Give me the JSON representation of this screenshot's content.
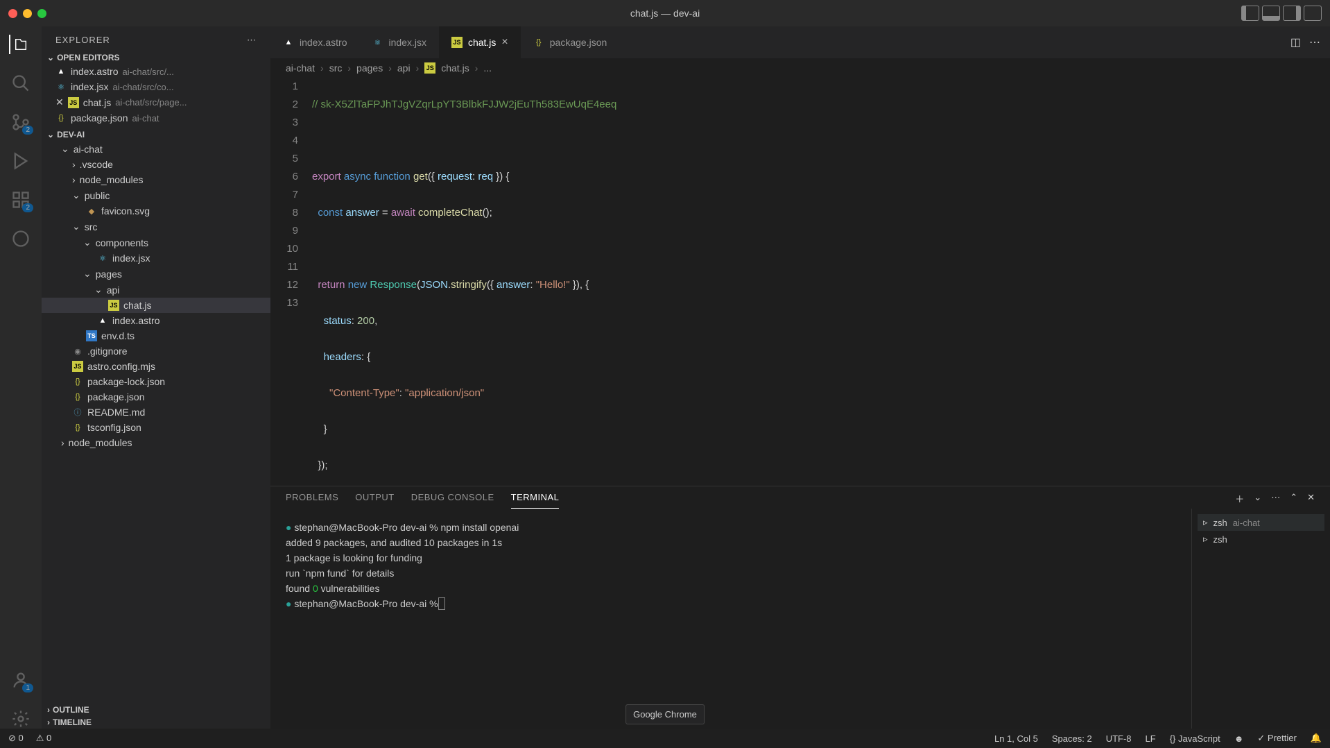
{
  "window": {
    "title": "chat.js — dev-ai"
  },
  "sidebar": {
    "title": "EXPLORER",
    "openEditors": "OPEN EDITORS",
    "project": "DEV-AI",
    "outline": "OUTLINE",
    "timeline": "TIMELINE",
    "editors": [
      {
        "name": "index.astro",
        "path": "ai-chat/src/..."
      },
      {
        "name": "index.jsx",
        "path": "ai-chat/src/co..."
      },
      {
        "name": "chat.js",
        "path": "ai-chat/src/page..."
      },
      {
        "name": "package.json",
        "path": "ai-chat"
      }
    ],
    "tree": {
      "aiChat": "ai-chat",
      "vscode": ".vscode",
      "nodeModules": "node_modules",
      "public": "public",
      "favicon": "favicon.svg",
      "src": "src",
      "components": "components",
      "indexJsx": "index.jsx",
      "pages": "pages",
      "api": "api",
      "chatJs": "chat.js",
      "indexAstro": "index.astro",
      "envdts": "env.d.ts",
      "gitignore": ".gitignore",
      "astroConfig": "astro.config.mjs",
      "pkgLock": "package-lock.json",
      "pkg": "package.json",
      "readme": "README.md",
      "tsconfig": "tsconfig.json",
      "nodeModules2": "node_modules"
    }
  },
  "tabs": [
    {
      "name": "index.astro"
    },
    {
      "name": "index.jsx"
    },
    {
      "name": "chat.js"
    },
    {
      "name": "package.json"
    }
  ],
  "breadcrumb": [
    "ai-chat",
    "src",
    "pages",
    "api",
    "chat.js",
    "..."
  ],
  "code": {
    "lineNumbers": [
      "1",
      "2",
      "3",
      "4",
      "5",
      "6",
      "7",
      "8",
      "9",
      "10",
      "11",
      "12",
      "13"
    ],
    "l1_comment": "// 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",
    "l3_export": "export",
    "l3_async": "async",
    "l3_function": "function",
    "l3_get": "get",
    "l3_request": "request",
    "l3_req": "req",
    "l4_const": "const",
    "l4_answer": "answer",
    "l4_await": "await",
    "l4_complete": "completeChat",
    "l6_return": "return",
    "l6_new": "new",
    "l6_Response": "Response",
    "l6_JSON": "JSON",
    "l6_stringify": "stringify",
    "l6_answer": "answer",
    "l6_hello": "\"Hello!\"",
    "l7_status": "status",
    "l7_200": "200",
    "l8_headers": "headers",
    "l9_ct": "\"Content-Type\"",
    "l9_val": "\"application/json\""
  },
  "panel": {
    "tabs": [
      "PROBLEMS",
      "OUTPUT",
      "DEBUG CONSOLE",
      "TERMINAL"
    ],
    "terminal": {
      "line1_prompt": "stephan@MacBook-Pro dev-ai % ",
      "line1_cmd": "npm install openai",
      "line2": "added 9 packages, and audited 10 packages in 1s",
      "line3": "1 package is looking for funding",
      "line4": "  run `npm fund` for details",
      "line5_a": "found ",
      "line5_b": "0",
      "line5_c": " vulnerabilities",
      "line6": "stephan@MacBook-Pro dev-ai % "
    },
    "shells": [
      {
        "name": "zsh",
        "detail": "ai-chat"
      },
      {
        "name": "zsh",
        "detail": ""
      }
    ]
  },
  "status": {
    "errors": "0",
    "warnings": "0",
    "cursor": "Ln 1, Col 5",
    "spaces": "Spaces: 2",
    "encoding": "UTF-8",
    "eol": "LF",
    "lang": "JavaScript",
    "prettier": "Prettier"
  },
  "tooltip": "Google Chrome",
  "badges": {
    "scm": "2",
    "account": "1"
  }
}
